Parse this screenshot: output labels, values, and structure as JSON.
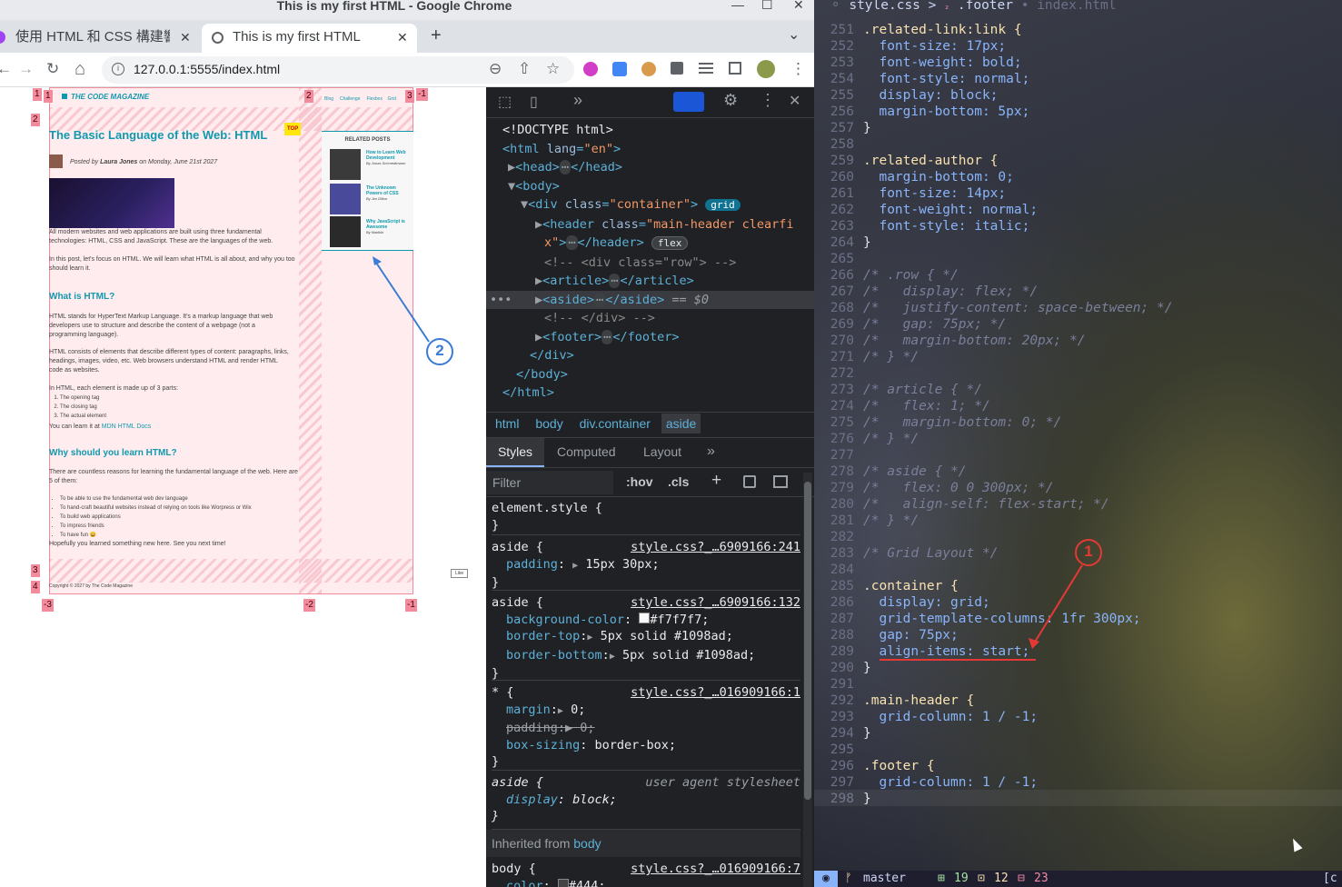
{
  "window": {
    "title": "This is my first HTML - Google Chrome",
    "min": "—",
    "max": "☐",
    "close": "✕"
  },
  "tabs": [
    {
      "label": "使用 HTML 和 CSS 構建響應",
      "close": "✕"
    },
    {
      "label": "This is my first HTML",
      "close": "✕"
    }
  ],
  "new_tab": "+",
  "tab_menu": "⌄",
  "address": {
    "url": "127.0.0.1:5555/index.html"
  },
  "nav": {
    "back": "←",
    "forward": "→",
    "reload": "↻",
    "home": "⌂"
  },
  "ext_icons": {
    "zoom": "⊖",
    "share": "⇧",
    "star": "☆"
  },
  "webpage": {
    "brand": "THE CODE MAGAZINE",
    "nav_links": [
      "Blog",
      "Challenge",
      "Flexbox",
      "Grid"
    ],
    "top_badge": "TOP",
    "title": "The Basic Language of the Web: HTML",
    "byline_prefix": "Posted by ",
    "author": "Laura Jones",
    "date": " on Monday, June 21st 2027",
    "p1": "All modern websites and web applications are built using three fundamental technologies: HTML, CSS and JavaScript. These are the languages of the web.",
    "p2": "In this post, let's focus on HTML. We will learn what HTML is all about, and why you too should learn it.",
    "h2a": "What is HTML?",
    "p3": "HTML stands for HyperText Markup Language. It's a markup language that web developers use to structure and describe the content of a webpage (not a programming language).",
    "p4": "HTML consists of elements that describe different types of content: paragraphs, links, headings, images, video, etc. Web browsers understand HTML and render HTML code as websites.",
    "p5": "In HTML, each element is made up of 3 parts:",
    "parts": [
      "The opening tag",
      "The closing tag",
      "The actual element"
    ],
    "learn_prefix": "You can learn it at ",
    "learn_link": "MDN HTML Docs",
    "h2b": "Why should you learn HTML?",
    "p6": "There are countless reasons for learning the fundamental language of the web. Here are 5 of them:",
    "reasons": [
      "To be able to use the fundamental web dev language",
      "To hand-craft beautiful websites instead of relying on tools like Worpress or Wix",
      "To build web applications",
      "To impress friends",
      "To have fun 😄"
    ],
    "p7": "Hopefully you learned something new here. See you next time!",
    "footer": "Copyright © 2027 by The Code Magazine",
    "related_title": "RELATED POSTS",
    "related": [
      {
        "title": "How to Learn Web Development",
        "author": "By Jonas Schmedtmann"
      },
      {
        "title": "The Unknown Powers of CSS",
        "author": "By Jim Dillon"
      },
      {
        "title": "Why JavaScript is Awesome",
        "author": "By Matilda"
      }
    ],
    "like": "Like",
    "grid_labels": {
      "r1": "1",
      "r2": "2",
      "r3": "3",
      "r4": "4",
      "c1": "1",
      "c2": "2",
      "c3": "3",
      "cn1": "-1",
      "bn3": "-3",
      "bn2": "-2",
      "bn1": "-1"
    },
    "annotation": "2"
  },
  "devtools": {
    "toolbar": {
      "inspect": "⬚",
      "device": "▯",
      "more": "»",
      "settings": "⚙",
      "kebab": "⋮",
      "close": "✕"
    },
    "dom": {
      "doctype": "<!DOCTYPE html>",
      "html_open": "<html ",
      "lang_attr": "lang",
      "lang_val": "\"en\"",
      "head": "<head>",
      "head_close": "</head>",
      "body_open": "<body>",
      "div_open": "<div ",
      "class_attr": "class",
      "container_val": "\"container\"",
      "grid_badge": "grid",
      "header_open": "<header ",
      "header_val": "\"main-header clearfi",
      "header_val2": "x\"",
      "header_close": "</header>",
      "flex_badge": "flex",
      "cmt1": "<!-- <div class=\"row\"> -->",
      "article_open": "<article>",
      "article_close": "</article>",
      "aside_open": "<aside>",
      "aside_close": "</aside>",
      "eq": "== $0",
      "cmt2": "<!-- </div> -->",
      "footer_open": "<footer>",
      "footer_close": "</footer>",
      "div_close": "</div>",
      "body_close": "</body>",
      "html_close": "</html>",
      "ellipsis": "⋯",
      "dots": "•••"
    },
    "breadcrumbs": [
      "html",
      "body",
      "div.container",
      "aside"
    ],
    "tabs": [
      "Styles",
      "Computed",
      "Layout",
      "»"
    ],
    "filter": {
      "placeholder": "Filter",
      "hov": ":hov",
      "cls": ".cls",
      "plus": "+"
    },
    "rules": [
      {
        "selector": "element.style {",
        "source": "",
        "decls": [],
        "close": "}"
      },
      {
        "selector": "aside {",
        "source": "style.css?_…6909166:241",
        "decls": [
          {
            "p": "padding",
            "v": "15px 30px;"
          }
        ],
        "close": "}"
      },
      {
        "selector": "aside {",
        "source": "style.css?_…6909166:132",
        "decls": [
          {
            "p": "background-color",
            "v": "#f7f7f7;"
          },
          {
            "p": "border-top",
            "v": "5px solid #1098ad;"
          },
          {
            "p": "border-bottom",
            "v": "5px solid #1098ad;"
          }
        ],
        "close": "}"
      },
      {
        "selector": "* {",
        "source": "style.css?_…016909166:1",
        "decls": [
          {
            "p": "margin",
            "v": "0;"
          },
          {
            "p": "padding",
            "v": "0;"
          },
          {
            "p": "box-sizing",
            "v": "border-box;"
          }
        ],
        "close": "}"
      },
      {
        "selector": "aside {",
        "source": "user agent stylesheet",
        "decls": [
          {
            "p": "display",
            "v": "block;"
          }
        ],
        "close": "}"
      }
    ],
    "inherited": "Inherited from ",
    "inherited_el": "body",
    "body_rule": {
      "selector": "body {",
      "source": "style.css?_…016909166:7",
      "p": "color",
      "v": "#444;"
    },
    "colors": {
      "bg_swatch": "#f7f7f7",
      "teal": "#1098ad",
      "grey": "#444444"
    }
  },
  "vim": {
    "tabline": {
      "file": "style.css",
      "sep": ">",
      "sym": "₂",
      "crumb": ".footer",
      "dot": "•",
      "other": "index.html"
    },
    "lines": [
      {
        "n": "251",
        "t": ".related-link:link {"
      },
      {
        "n": "252",
        "t": "  font-size: 17px;"
      },
      {
        "n": "253",
        "t": "  font-weight: bold;"
      },
      {
        "n": "254",
        "t": "  font-style: normal;"
      },
      {
        "n": "255",
        "t": "  display: block;"
      },
      {
        "n": "256",
        "t": "  margin-bottom: 5px;"
      },
      {
        "n": "257",
        "t": "}"
      },
      {
        "n": "258",
        "t": ""
      },
      {
        "n": "259",
        "t": ".related-author {"
      },
      {
        "n": "260",
        "t": "  margin-bottom: 0;"
      },
      {
        "n": "261",
        "t": "  font-size: 14px;"
      },
      {
        "n": "262",
        "t": "  font-weight: normal;"
      },
      {
        "n": "263",
        "t": "  font-style: italic;"
      },
      {
        "n": "264",
        "t": "}"
      },
      {
        "n": "265",
        "t": ""
      },
      {
        "n": "266",
        "t": "/* .row { */"
      },
      {
        "n": "267",
        "t": "/*   display: flex; */"
      },
      {
        "n": "268",
        "t": "/*   justify-content: space-between; */"
      },
      {
        "n": "269",
        "t": "/*   gap: 75px; */"
      },
      {
        "n": "270",
        "t": "/*   margin-bottom: 20px; */"
      },
      {
        "n": "271",
        "t": "/* } */"
      },
      {
        "n": "272",
        "t": ""
      },
      {
        "n": "273",
        "t": "/* article { */"
      },
      {
        "n": "274",
        "t": "/*   flex: 1; */"
      },
      {
        "n": "275",
        "t": "/*   margin-bottom: 0; */"
      },
      {
        "n": "276",
        "t": "/* } */"
      },
      {
        "n": "277",
        "t": ""
      },
      {
        "n": "278",
        "t": "/* aside { */"
      },
      {
        "n": "279",
        "t": "/*   flex: 0 0 300px; */"
      },
      {
        "n": "280",
        "t": "/*   align-self: flex-start; */"
      },
      {
        "n": "281",
        "t": "/* } */"
      },
      {
        "n": "282",
        "t": ""
      },
      {
        "n": "283",
        "t": "/* Grid Layout */"
      },
      {
        "n": "284",
        "t": ""
      },
      {
        "n": "285",
        "t": ".container {"
      },
      {
        "n": "286",
        "t": "  display: grid;"
      },
      {
        "n": "287",
        "t": "  grid-template-columns: 1fr 300px;"
      },
      {
        "n": "288",
        "t": "  gap: 75px;"
      },
      {
        "n": "289",
        "t": "  align-items: start;"
      },
      {
        "n": "290",
        "t": "}"
      },
      {
        "n": "291",
        "t": ""
      },
      {
        "n": "292",
        "t": ".main-header {"
      },
      {
        "n": "293",
        "t": "  grid-column: 1 / -1;"
      },
      {
        "n": "294",
        "t": "}"
      },
      {
        "n": "295",
        "t": ""
      },
      {
        "n": "296",
        "t": ".footer {"
      },
      {
        "n": "297",
        "t": "  grid-column: 1 / -1;"
      },
      {
        "n": "298",
        "t": "}"
      }
    ],
    "annotation": "1",
    "statusline": {
      "mode": "◉",
      "branch_icon": "ᚠ",
      "branch": "master",
      "added": "19",
      "changed": "12",
      "removed": "23",
      "right": "[c"
    },
    "colors": {
      "selector": "#f9e2af",
      "property": "#89b4fa",
      "number": "#fab387",
      "comment": "#7a7f9a",
      "annotation": "#e53935"
    }
  }
}
